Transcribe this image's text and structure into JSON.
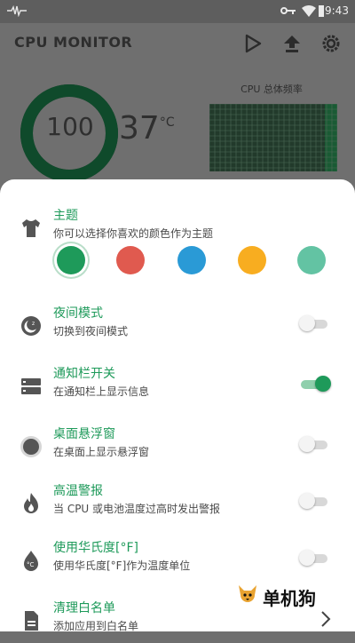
{
  "status_bar": {
    "time": "9:43",
    "icons": [
      "pulse-icon",
      "key-icon",
      "wifi-icon",
      "battery-icon"
    ]
  },
  "app": {
    "title": "CPU MONITOR",
    "actions": [
      "play-store-icon",
      "upload-icon",
      "settings-icon"
    ]
  },
  "dashboard": {
    "cpu_usage": "100",
    "cpu_usage_fraction": 1.0,
    "temperature": "37",
    "temperature_unit": "°C",
    "frequency_label": "CPU 总体频率"
  },
  "colors": {
    "accent": "#1e9a5a",
    "theme_swatches": [
      "#1e9a5a",
      "#e05a4f",
      "#2a9ad6",
      "#f8ad20",
      "#63c3a3"
    ]
  },
  "settings": {
    "theme": {
      "title": "主题",
      "desc": "你可以选择你喜欢的颜色作为主题",
      "icon": "shirt-icon",
      "selected_index": 0
    },
    "night_mode": {
      "title": "夜间模式",
      "desc": "切换到夜间模式",
      "icon": "night-mode-icon",
      "enabled": false
    },
    "notification": {
      "title": "通知栏开关",
      "desc": "在通知栏上显示信息",
      "icon": "notification-bar-icon",
      "enabled": true
    },
    "floating_window": {
      "title": "桌面悬浮窗",
      "desc": "在桌面上显示悬浮窗",
      "icon": "floating-window-icon",
      "enabled": false
    },
    "high_temp_alert": {
      "title": "高温警报",
      "desc": "当 CPU 或电池温度过高时发出警报",
      "icon": "flame-icon",
      "enabled": false
    },
    "fahrenheit": {
      "title": "使用华氏度[°F]",
      "desc": "使用华氏度[°F]作为温度单位",
      "icon": "temperature-drop-icon",
      "enabled": false
    },
    "whitelist": {
      "title": "清理白名单",
      "desc": "添加应用到白名单",
      "icon": "document-icon"
    }
  },
  "watermark": {
    "text": "单机狗"
  }
}
